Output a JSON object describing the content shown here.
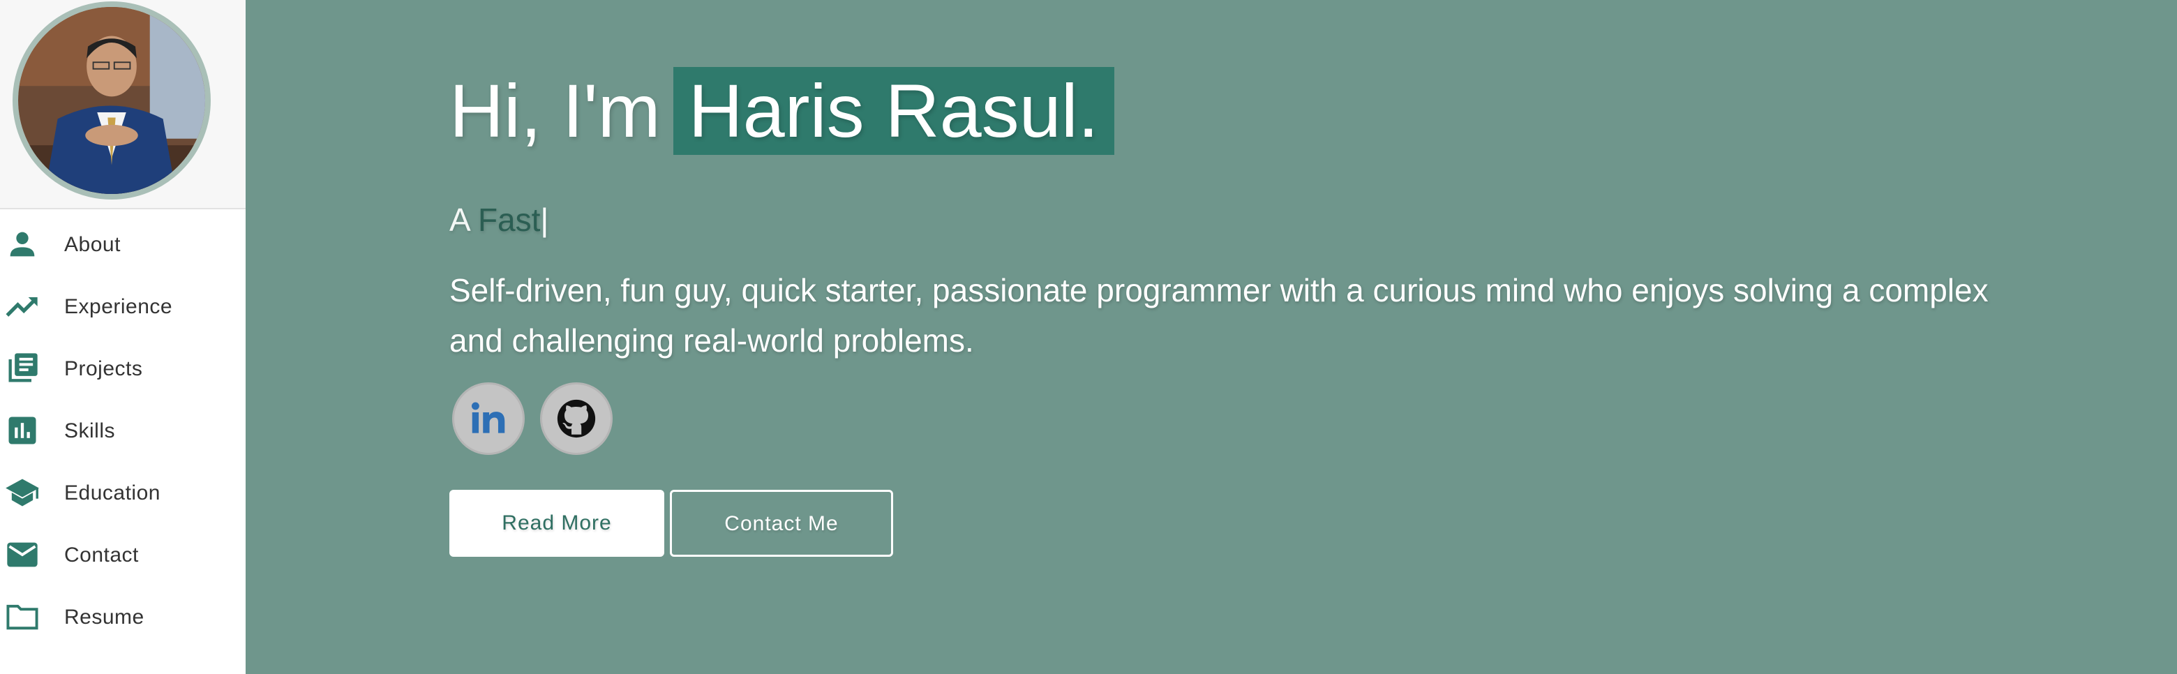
{
  "profile": {
    "avatar_alt": "Haris Rasul profile photo"
  },
  "nav": {
    "items": [
      {
        "label": "About",
        "icon": "person-icon"
      },
      {
        "label": "Experience",
        "icon": "trending-up-icon"
      },
      {
        "label": "Projects",
        "icon": "library-books-icon"
      },
      {
        "label": "Skills",
        "icon": "bar-chart-icon"
      },
      {
        "label": "Education",
        "icon": "school-icon"
      },
      {
        "label": "Contact",
        "icon": "mail-icon"
      },
      {
        "label": "Resume",
        "icon": "folder-icon"
      }
    ]
  },
  "hero": {
    "greeting": "Hi, I'm",
    "name": "Haris Rasul.",
    "tagline_prefix": "A",
    "tagline_typed": "Fast",
    "tagline_cursor": "|",
    "bio": "Self-driven, fun guy, quick starter, passionate programmer with a curious mind who enjoys solving a complex and challenging real-world problems."
  },
  "socials": [
    {
      "name": "linkedin-icon"
    },
    {
      "name": "github-icon"
    }
  ],
  "buttons": {
    "read_more": "Read More",
    "contact_me": "Contact Me"
  },
  "colors": {
    "accent": "#2f7a6c",
    "background": "#6f968c",
    "sidebar": "#ffffff",
    "icon": "#2f7a6c"
  }
}
